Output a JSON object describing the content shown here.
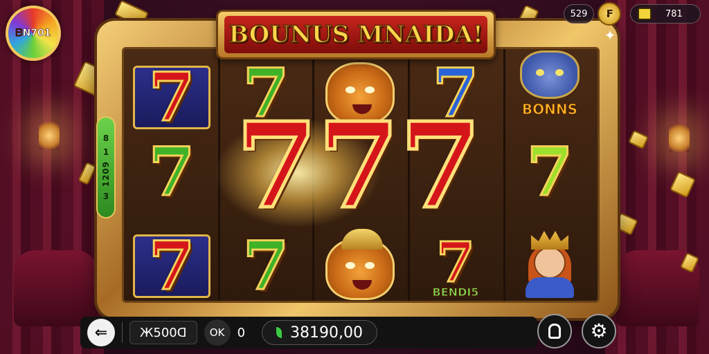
{
  "level_badge": {
    "text": "ᗷN701"
  },
  "banner": {
    "title": "BOUNUS MNAIDA!"
  },
  "hud": {
    "left_counter": "529",
    "coin_symbol": "₣",
    "balance_small": "781"
  },
  "side_paytable": {
    "lines": [
      "8",
      "1",
      "1209",
      "3"
    ]
  },
  "reels": {
    "bonus_label": "BONNS",
    "bendis_label": "BENDI5"
  },
  "control_bar": {
    "back_icon": "back-arrow-icon",
    "bet_value": "Ж500ᗡ",
    "ok_label": "OK",
    "zero_value": "0",
    "balance_value": "38190,00"
  },
  "icons": {
    "shield": "shield-icon",
    "settings": "gear-icon",
    "pin": "pin-icon"
  },
  "colors": {
    "banner_red": "#c7241c",
    "gold": "#f4cc6a",
    "seven_red": "#d4161a",
    "seven_green": "#3fb227",
    "seven_blue": "#2a63d8"
  }
}
